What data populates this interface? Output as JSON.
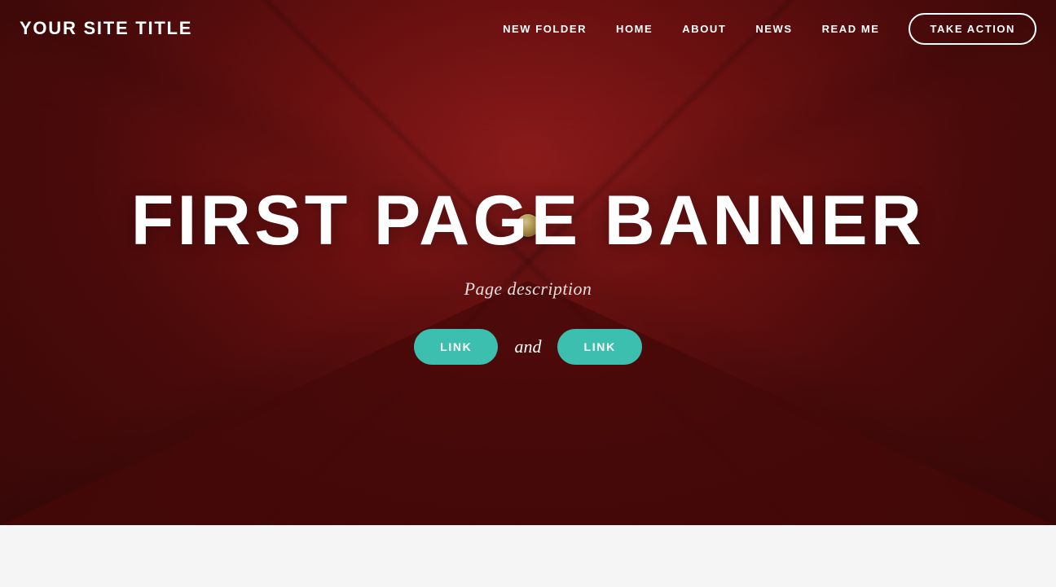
{
  "header": {
    "site_title": "YOUR SITE TITLE",
    "nav": {
      "items": [
        {
          "label": "NEW FOLDER",
          "id": "nav-new-folder"
        },
        {
          "label": "HOME",
          "id": "nav-home"
        },
        {
          "label": "ABOUT",
          "id": "nav-about"
        },
        {
          "label": "NEWS",
          "id": "nav-news"
        },
        {
          "label": "READ ME",
          "id": "nav-read-me"
        }
      ],
      "cta_label": "TAKE ACTION"
    }
  },
  "hero": {
    "banner_title": "FIRST PAGE BANNER",
    "description": "Page description",
    "button1_label": "LINK",
    "conjunction": "and",
    "button2_label": "LINK"
  },
  "colors": {
    "teal": "#3dbfb0",
    "dark_red": "#6B1010",
    "white": "#ffffff"
  }
}
